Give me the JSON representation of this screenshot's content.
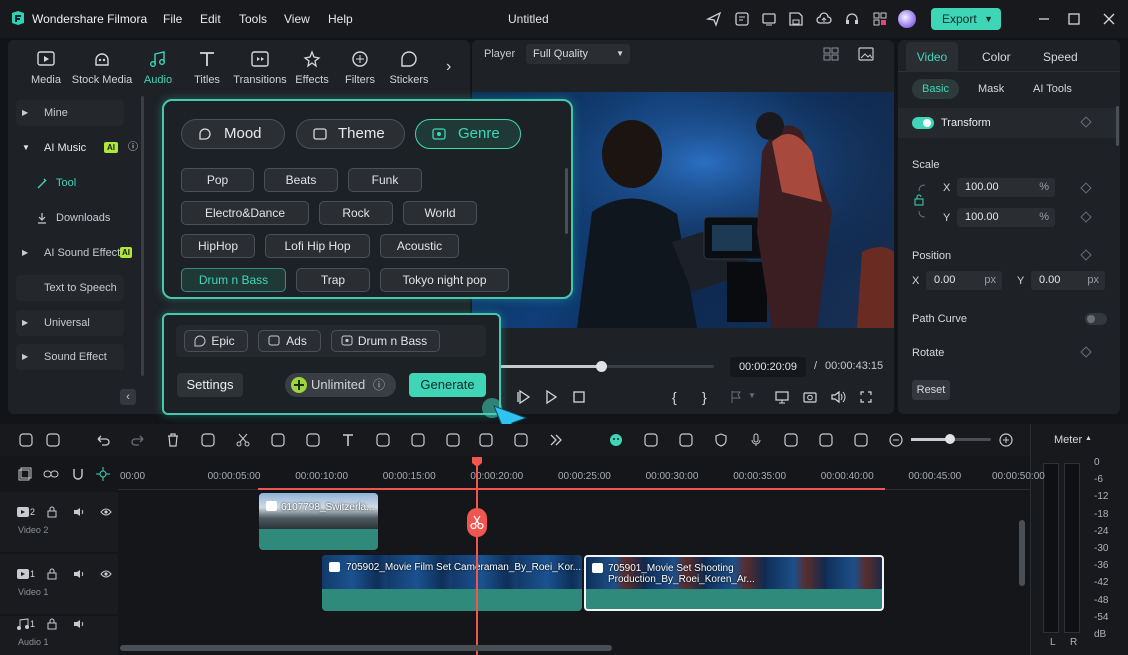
{
  "app": {
    "name": "Wondershare Filmora",
    "title": "Untitled",
    "export_label": "Export"
  },
  "menu": [
    "File",
    "Edit",
    "Tools",
    "View",
    "Help"
  ],
  "toolbar_tabs": [
    {
      "label": "Media",
      "icon": "media-icon"
    },
    {
      "label": "Stock Media",
      "icon": "stock-media-icon"
    },
    {
      "label": "Audio",
      "icon": "audio-icon"
    },
    {
      "label": "Titles",
      "icon": "titles-icon"
    },
    {
      "label": "Transitions",
      "icon": "transitions-icon"
    },
    {
      "label": "Effects",
      "icon": "effects-icon"
    },
    {
      "label": "Filters",
      "icon": "filters-icon"
    },
    {
      "label": "Stickers",
      "icon": "stickers-icon"
    }
  ],
  "sidebar": {
    "items": [
      "Mine",
      "AI Music",
      "Tool",
      "Downloads",
      "AI Sound Effect",
      "Text to Speech",
      "Universal Musi...",
      "Sound Effect"
    ],
    "ai_badge": "AI"
  },
  "ai_music": {
    "modes": [
      "Mood",
      "Theme",
      "Genre"
    ],
    "genres": [
      "Pop",
      "Beats",
      "Funk",
      "Electro&Dance",
      "Rock",
      "World",
      "HipHop",
      "Lofi Hip Hop",
      "Acoustic",
      "Drum n Bass",
      "Trap",
      "Tokyo night pop"
    ],
    "selected_tags": [
      "Epic",
      "Ads",
      "Drum n Bass"
    ],
    "settings_label": "Settings",
    "unlimited_label": "Unlimited",
    "generate_label": "Generate"
  },
  "player": {
    "label": "Player",
    "quality": "Full Quality",
    "current_time": "00:00:20:09",
    "separator": "/",
    "total_time": "00:00:43:15",
    "progress": 0.47
  },
  "properties": {
    "tabs": [
      "Video",
      "Color",
      "Speed"
    ],
    "subtabs": [
      "Basic",
      "Mask",
      "AI Tools"
    ],
    "transform_label": "Transform",
    "scale_label": "Scale",
    "scale_x": "100.00",
    "scale_y": "100.00",
    "percent": "%",
    "x_label": "X",
    "y_label": "Y",
    "position_label": "Position",
    "pos_x": "0.00",
    "pos_y": "0.00",
    "px": "px",
    "path_curve_label": "Path Curve",
    "rotate_label": "Rotate",
    "reset_label": "Reset"
  },
  "timeline": {
    "ruler": [
      "00:00",
      "00:00:05:00",
      "00:00:10:00",
      "00:00:15:00",
      "00:00:20:00",
      "00:00:25:00",
      "00:00:30:00",
      "00:00:35:00",
      "00:00:40:00",
      "00:00:45:00",
      "00:00:50:00"
    ],
    "tracks": [
      {
        "num": "2",
        "name": "Video 2"
      },
      {
        "num": "1",
        "name": "Video 1"
      },
      {
        "num": "1",
        "name": "Audio 1"
      }
    ],
    "clips": [
      "6107798_Switzerla...",
      "705902_Movie Film Set Cameraman_By_Roei_Kor...",
      "705901_Movie Set Shooting Production_By_Roei_Koren_Ar..."
    ]
  },
  "meter": {
    "label": "Meter",
    "scale": [
      "0",
      "-6",
      "-12",
      "-18",
      "-24",
      "-30",
      "-36",
      "-42",
      "-48",
      "-54",
      "dB"
    ],
    "left": "L",
    "right": "R"
  },
  "colors": {
    "accent": "#3fd6b8",
    "bg": "#121418",
    "panel": "#1e2126",
    "playhead": "#f0554f"
  }
}
